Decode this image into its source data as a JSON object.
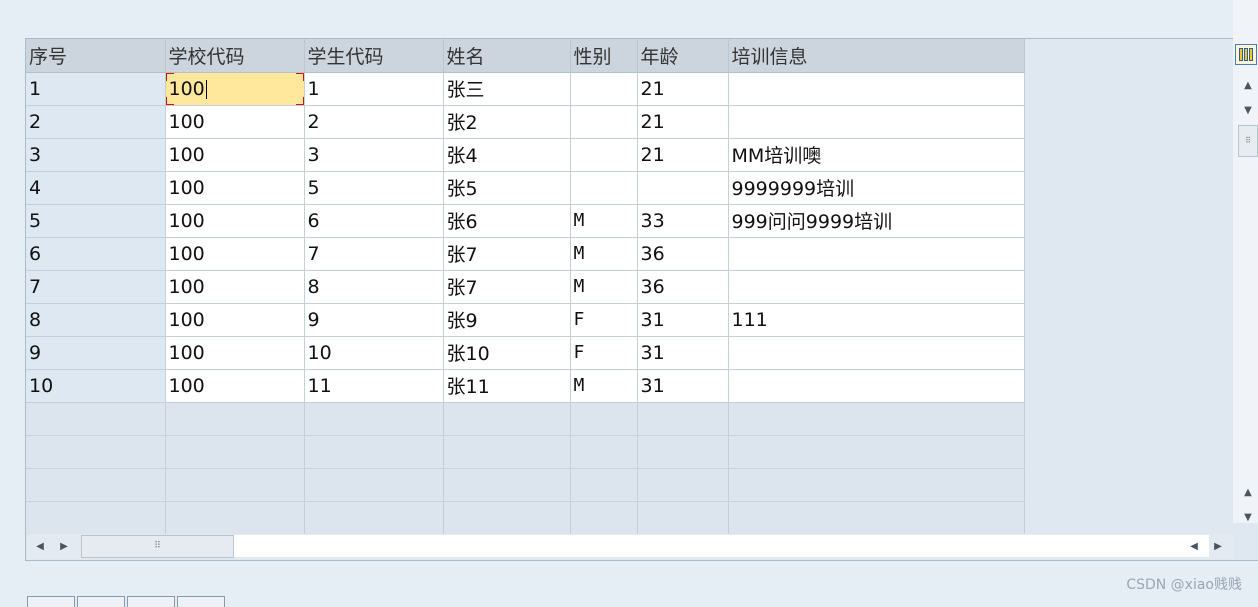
{
  "table": {
    "headers": [
      "序号",
      "学校代码",
      "学生代码",
      "姓名",
      "性别",
      "年龄",
      "培训信息"
    ],
    "rows": [
      [
        "1",
        "100",
        "1",
        "张三",
        "",
        "21",
        ""
      ],
      [
        "2",
        "100",
        "2",
        "张2",
        "",
        "21",
        ""
      ],
      [
        "3",
        "100",
        "3",
        "张4",
        "",
        "21",
        "MM培训噢"
      ],
      [
        "4",
        "100",
        "5",
        "张5",
        "",
        "",
        "9999999培训"
      ],
      [
        "5",
        "100",
        "6",
        "张6",
        "M",
        "33",
        "999问问9999培训"
      ],
      [
        "6",
        "100",
        "7",
        "张7",
        "M",
        "36",
        ""
      ],
      [
        "7",
        "100",
        "8",
        "张7",
        "M",
        "36",
        ""
      ],
      [
        "8",
        "100",
        "9",
        "张9",
        "F",
        "31",
        "111"
      ],
      [
        "9",
        "100",
        "10",
        "张10",
        "F",
        "31",
        ""
      ],
      [
        "10",
        "100",
        "11",
        "张11",
        "M",
        "31",
        ""
      ]
    ],
    "empty_rows": 4,
    "active_cell": {
      "row": 0,
      "col": 1
    }
  },
  "icons": {
    "layout": "column-layout-icon",
    "scroll_up": "arrow-up-icon",
    "scroll_down": "arrow-down-icon",
    "scroll_left": "arrow-left-icon",
    "scroll_right": "arrow-right-icon"
  },
  "watermark": "CSDN @xiao贱贱",
  "colors": {
    "header_bg": "#ccd5de",
    "active_cell_bg": "#ffe89c",
    "active_cell_border": "#d0111a"
  }
}
